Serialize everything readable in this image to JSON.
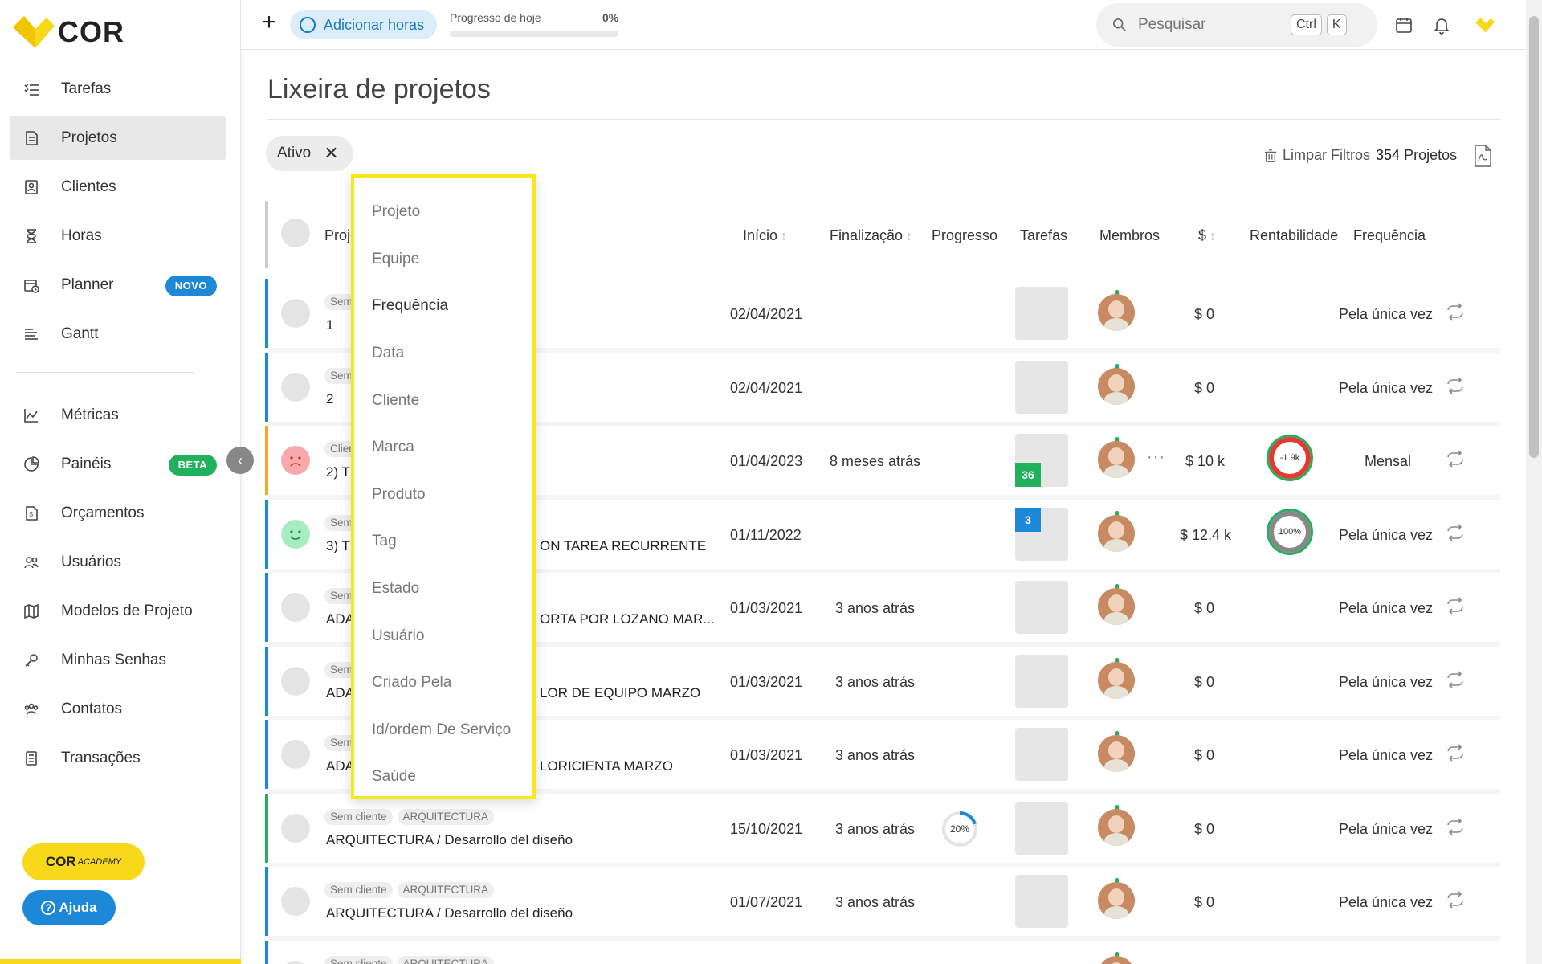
{
  "app": {
    "name": "COR"
  },
  "colors": {
    "brand_yellow": "#f8d81a",
    "accent_blue": "#1e88d8",
    "green": "#21b15c",
    "orange": "#f5a623",
    "red": "#e53935"
  },
  "sidebar": {
    "items": [
      {
        "label": "Tarefas",
        "icon": "tasks-list-icon"
      },
      {
        "label": "Projetos",
        "icon": "project-file-icon",
        "active": true
      },
      {
        "label": "Clientes",
        "icon": "client-card-icon"
      },
      {
        "label": "Horas",
        "icon": "hourglass-icon"
      },
      {
        "label": "Planner",
        "icon": "calendar-clock-icon",
        "badge": "NOVO"
      },
      {
        "label": "Gantt",
        "icon": "gantt-bars-icon"
      },
      {
        "label": "Métricas",
        "icon": "area-chart-icon"
      },
      {
        "label": "Painéis",
        "icon": "pie-chart-icon",
        "badge": "BETA"
      },
      {
        "label": "Orçamentos",
        "icon": "budget-doc-icon"
      },
      {
        "label": "Usuários",
        "icon": "users-icon"
      },
      {
        "label": "Modelos de Projeto",
        "icon": "map-icon"
      },
      {
        "label": "Minhas Senhas",
        "icon": "key-icon"
      },
      {
        "label": "Contatos",
        "icon": "contacts-icon"
      },
      {
        "label": "Transações",
        "icon": "ledger-icon"
      }
    ],
    "academy_label": "COR",
    "academy_sub": "ACADEMY",
    "help_label": "Ajuda"
  },
  "topbar": {
    "add_hours_label": "Adicionar horas",
    "progress_label": "Progresso de hoje",
    "progress_value": "0%",
    "progress_fraction": 0,
    "search_placeholder": "Pesquisar",
    "shortcut_keys": [
      "Ctrl",
      "K"
    ]
  },
  "page": {
    "title": "Lixeira de projetos",
    "filter_chip": "Ativo",
    "clear_filters": "Limpar Filtros",
    "project_count": "354",
    "project_count_label": "Projetos"
  },
  "table": {
    "headers": {
      "project": "Proje",
      "start": "Início",
      "end": "Finalização",
      "progress": "Progresso",
      "tasks": "Tarefas",
      "members": "Membros",
      "money": "$",
      "profitability": "Rentabilidade",
      "frequency": "Frequência"
    },
    "rows": [
      {
        "tags": [
          "Sem"
        ],
        "name": "1",
        "name2": "",
        "start": "02/04/2021",
        "end": "",
        "tasks": "",
        "money": "$  0",
        "profit": "",
        "freq": "Pela única vez",
        "color": "#1e88d8",
        "health": "neutral"
      },
      {
        "tags": [
          "Sem"
        ],
        "name": "2",
        "name2": "",
        "start": "02/04/2021",
        "end": "",
        "tasks": "",
        "money": "$  0",
        "profit": "",
        "freq": "Pela única vez",
        "color": "#1e88d8",
        "health": "neutral"
      },
      {
        "tags": [
          "Clien"
        ],
        "name": "2) TE",
        "name2": "",
        "start": "01/04/2023",
        "end": "8 meses atrás",
        "tasks": "36",
        "money": "$  10 k",
        "profit": "-1.9k",
        "freq": "Mensal",
        "color": "#f5a623",
        "health": "sad"
      },
      {
        "tags": [
          "Sem"
        ],
        "name": "3) TE",
        "name2": "ON TAREA RECURRENTE",
        "start": "01/11/2022",
        "end": "",
        "tasks": "3",
        "money": "$  12.4 k",
        "profit": "100%",
        "freq": "Pela única vez",
        "color": "#1e88d8",
        "health": "happy"
      },
      {
        "tags": [
          "Sem"
        ],
        "name": "ADA",
        "name2": "ORTA POR LOZANO MAR...",
        "start": "01/03/2021",
        "end": "3 anos atrás",
        "tasks": "",
        "money": "$  0",
        "profit": "",
        "freq": "Pela única vez",
        "color": "#1e88d8",
        "health": "neutral"
      },
      {
        "tags": [
          "Sem"
        ],
        "name": "ADA",
        "name2": "LOR DE EQUIPO MARZO",
        "start": "01/03/2021",
        "end": "3 anos atrás",
        "tasks": "",
        "money": "$  0",
        "profit": "",
        "freq": "Pela única vez",
        "color": "#1e88d8",
        "health": "neutral"
      },
      {
        "tags": [
          "Sem"
        ],
        "name": "ADA",
        "name2": "LORICIENTA MARZO",
        "start": "01/03/2021",
        "end": "3 anos atrás",
        "tasks": "",
        "money": "$  0",
        "profit": "",
        "freq": "Pela única vez",
        "color": "#1e88d8",
        "health": "neutral"
      },
      {
        "tags": [
          "Sem cliente",
          "ARQUITECTURA"
        ],
        "name": "ARQUITECTURA / Desarrollo del diseño",
        "name2": "",
        "start": "15/10/2021",
        "end": "3 anos atrás",
        "progress": "20%",
        "tasks": "",
        "money": "$  0",
        "profit": "",
        "freq": "Pela única vez",
        "color": "#21b15c",
        "health": "neutral"
      },
      {
        "tags": [
          "Sem cliente",
          "ARQUITECTURA"
        ],
        "name": "ARQUITECTURA / Desarrollo del diseño",
        "name2": "",
        "start": "01/07/2021",
        "end": "3 anos atrás",
        "tasks": "",
        "money": "$  0",
        "profit": "",
        "freq": "Pela única vez",
        "color": "#1e88d8",
        "health": "neutral"
      },
      {
        "tags": [
          "Sem cliente",
          "ARQUITECTURA"
        ],
        "name": "",
        "name2": "",
        "start": "",
        "end": "",
        "tasks": "",
        "money": "",
        "profit": "",
        "freq": "",
        "color": "#1e88d8",
        "health": "neutral"
      }
    ]
  },
  "dropdown": {
    "items": [
      "Projeto",
      "Equipe",
      "Frequência",
      "Data",
      "Cliente",
      "Marca",
      "Produto",
      "Tag",
      "Estado",
      "Usuário",
      "Criado Pela",
      "Id/ordem De Serviço",
      "Saúde"
    ],
    "highlighted": "Frequência"
  }
}
